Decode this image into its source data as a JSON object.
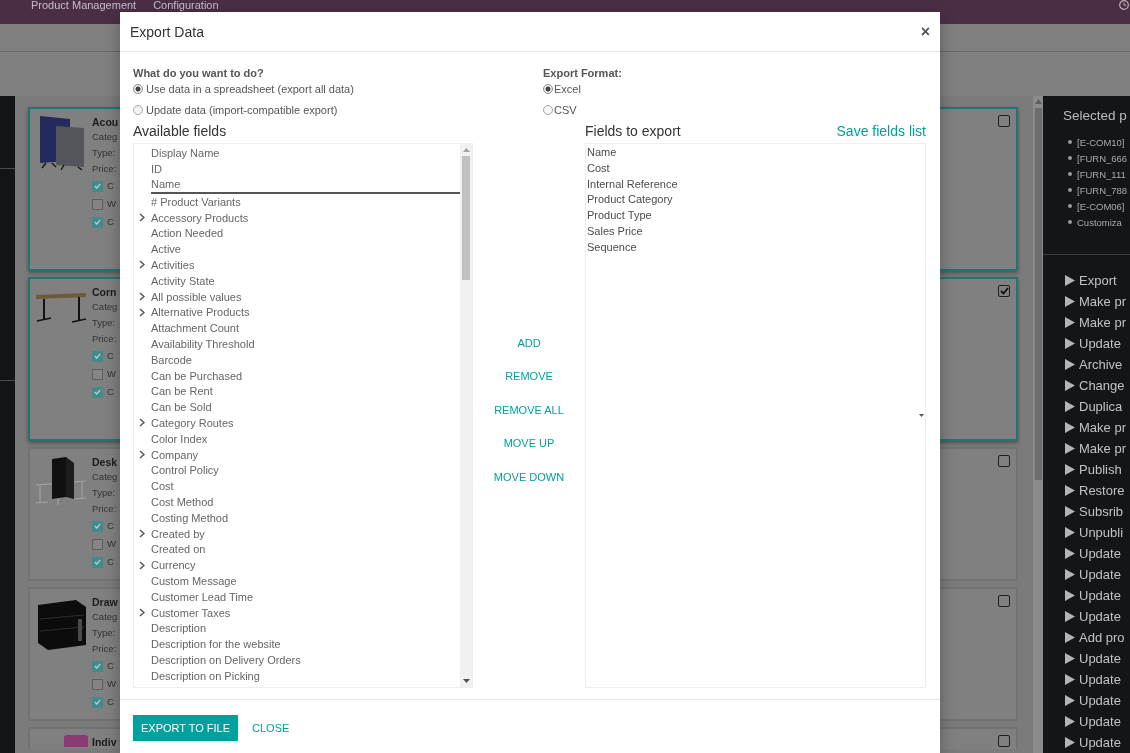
{
  "navbar": {
    "menu": [
      {
        "label": "Product Management"
      },
      {
        "label": "Configuration"
      }
    ]
  },
  "kanban": {
    "cards": [
      {
        "title": "Acou",
        "lines": [
          "Categ",
          "Type:",
          "Price:"
        ],
        "checks": [
          {
            "label": "C",
            "checked": true
          },
          {
            "label": "W",
            "checked": false
          },
          {
            "label": "C",
            "checked": true
          }
        ],
        "highlighted": true,
        "selected": false
      },
      {
        "title": "Corn",
        "lines": [
          "Categ",
          "Type:",
          "Price:"
        ],
        "checks": [
          {
            "label": "C",
            "checked": true
          },
          {
            "label": "W",
            "checked": false
          },
          {
            "label": "C",
            "checked": true
          }
        ],
        "highlighted": true,
        "selected": true
      },
      {
        "title": "Desk",
        "lines": [
          "Categ",
          "Type:",
          "Price:"
        ],
        "checks": [
          {
            "label": "C",
            "checked": true
          },
          {
            "label": "W",
            "checked": false
          },
          {
            "label": "C",
            "checked": true
          }
        ],
        "highlighted": false,
        "selected": false
      },
      {
        "title": "Draw",
        "lines": [
          "Categ",
          "Type:",
          "Price:"
        ],
        "checks": [
          {
            "label": "C",
            "checked": true
          },
          {
            "label": "W",
            "checked": false
          },
          {
            "label": "C",
            "checked": true
          }
        ],
        "highlighted": false,
        "selected": false
      },
      {
        "title": "Indiv",
        "highlighted": false,
        "selected": false
      }
    ]
  },
  "side_panel": {
    "title": "Selected p",
    "records": [
      "[E-COM10]",
      "[FURN_666",
      "[FURN_111",
      "[FURN_788",
      "[E-COM06]",
      "Customiza"
    ],
    "actions": [
      "Export",
      "Make pr",
      "Make pr",
      "Update",
      "Archive",
      "Change",
      "Duplica",
      "Make pr",
      "Make pr",
      "Publish",
      "Restore",
      "Subsrib",
      "Unpubli",
      "Update",
      "Update",
      "Update",
      "Update",
      "Add pro",
      "Update",
      "Update",
      "Update",
      "Update",
      "Update"
    ]
  },
  "dialog": {
    "title": "Export Data",
    "close": "×",
    "question": "What do you want to do?",
    "modes": [
      {
        "label": "Use data in a spreadsheet (export all data)",
        "selected": true
      },
      {
        "label": "Update data (import-compatible export)",
        "selected": false
      }
    ],
    "format_label": "Export Format:",
    "formats": [
      {
        "label": "Excel",
        "selected": true
      },
      {
        "label": "CSV",
        "selected": false
      }
    ],
    "available_title": "Available fields",
    "pinned_fields": [
      {
        "label": "Display Name",
        "expandable": false
      },
      {
        "label": "ID",
        "expandable": false
      },
      {
        "label": "Name",
        "expandable": false
      }
    ],
    "fields": [
      {
        "label": "# Product Variants",
        "expandable": false
      },
      {
        "label": "Accessory Products",
        "expandable": true
      },
      {
        "label": "Action Needed",
        "expandable": false
      },
      {
        "label": "Active",
        "expandable": false
      },
      {
        "label": "Activities",
        "expandable": true
      },
      {
        "label": "Activity State",
        "expandable": false
      },
      {
        "label": "All possible values",
        "expandable": true
      },
      {
        "label": "Alternative Products",
        "expandable": true
      },
      {
        "label": "Attachment Count",
        "expandable": false
      },
      {
        "label": "Availability Threshold",
        "expandable": false
      },
      {
        "label": "Barcode",
        "expandable": false
      },
      {
        "label": "Can be Purchased",
        "expandable": false
      },
      {
        "label": "Can be Rent",
        "expandable": false
      },
      {
        "label": "Can be Sold",
        "expandable": false
      },
      {
        "label": "Category Routes",
        "expandable": true
      },
      {
        "label": "Color Index",
        "expandable": false
      },
      {
        "label": "Company",
        "expandable": true
      },
      {
        "label": "Control Policy",
        "expandable": false
      },
      {
        "label": "Cost",
        "expandable": false
      },
      {
        "label": "Cost Method",
        "expandable": false
      },
      {
        "label": "Costing Method",
        "expandable": false
      },
      {
        "label": "Created by",
        "expandable": true
      },
      {
        "label": "Created on",
        "expandable": false
      },
      {
        "label": "Currency",
        "expandable": true
      },
      {
        "label": "Custom Message",
        "expandable": false
      },
      {
        "label": "Customer Lead Time",
        "expandable": false
      },
      {
        "label": "Customer Taxes",
        "expandable": true
      },
      {
        "label": "Description",
        "expandable": false
      },
      {
        "label": "Description for the website",
        "expandable": false
      },
      {
        "label": "Description on Delivery Orders",
        "expandable": false
      },
      {
        "label": "Description on Picking",
        "expandable": false
      }
    ],
    "move_buttons": [
      "ADD",
      "REMOVE",
      "REMOVE ALL",
      "MOVE UP",
      "MOVE DOWN"
    ],
    "export_title": "Fields to export",
    "save_link": "Save fields list",
    "export_fields": [
      "Name",
      "Cost",
      "Internal Reference",
      "Product Category",
      "Product Type",
      "Sales Price",
      "Sequence"
    ],
    "footer_buttons": [
      {
        "label": "EXPORT TO FILE",
        "kind": "primary"
      },
      {
        "label": "CLOSE",
        "kind": "link"
      }
    ]
  }
}
